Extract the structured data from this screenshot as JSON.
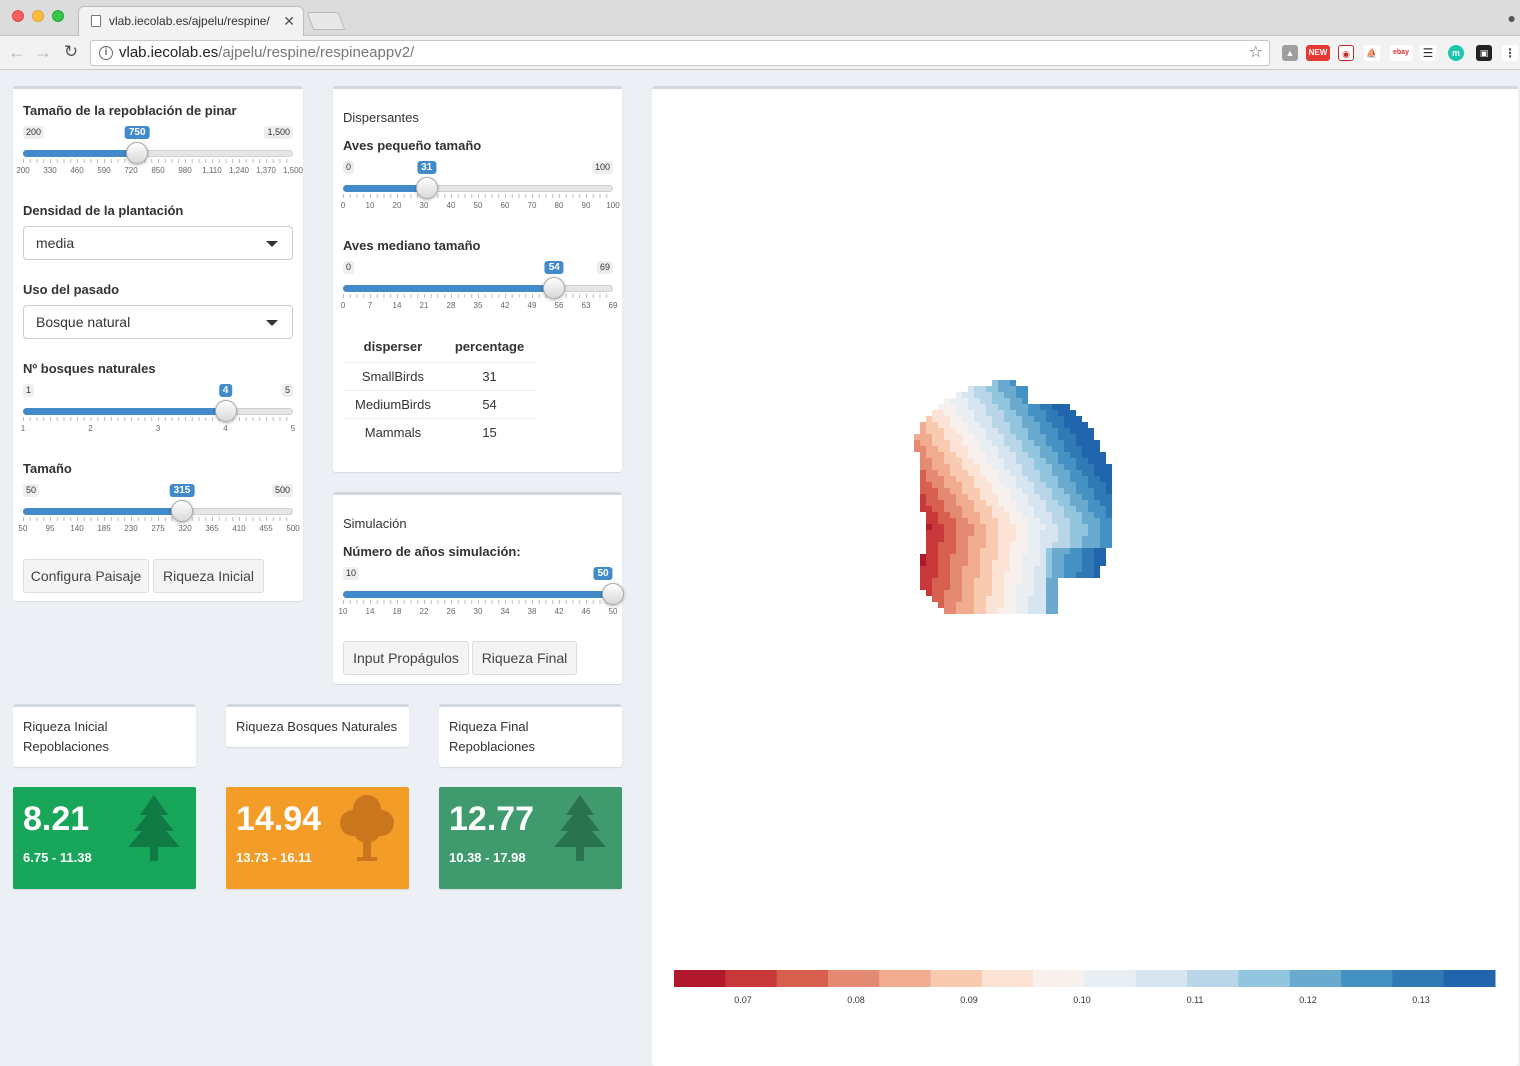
{
  "browser": {
    "tab_title": "vlab.iecolab.es/ajpelu/respine/",
    "url_host": "vlab.iecolab.es",
    "url_path": "/ajpelu/respine/respineappv2/",
    "extension_badge": "NEW"
  },
  "landscape": {
    "pine_size": {
      "label": "Tamaño de la repoblación de pinar",
      "min": 200,
      "max": 1500,
      "value": 750,
      "min_label": "200",
      "max_label": "1,500",
      "value_label": "750",
      "ticks": [
        "200",
        "330",
        "460",
        "590",
        "720",
        "850",
        "980",
        "1,110",
        "1,240",
        "1,370",
        "1,500"
      ]
    },
    "density": {
      "label": "Densidad de la plantación",
      "value": "media"
    },
    "past_use": {
      "label": "Uso del pasado",
      "value": "Bosque natural"
    },
    "n_forests": {
      "label": "Nº bosques naturales",
      "min": 1,
      "max": 5,
      "value": 4,
      "min_label": "1",
      "max_label": "5",
      "value_label": "4",
      "ticks": [
        "1",
        "2",
        "3",
        "4",
        "5"
      ]
    },
    "size": {
      "label": "Tamaño",
      "min": 50,
      "max": 500,
      "value": 315,
      "min_label": "50",
      "max_label": "500",
      "value_label": "315",
      "ticks": [
        "50",
        "95",
        "140",
        "185",
        "230",
        "275",
        "320",
        "365",
        "410",
        "455",
        "500"
      ]
    },
    "configure_button": "Configura Paisaje",
    "initial_richness_button": "Riqueza Inicial"
  },
  "dispersers": {
    "title": "Dispersantes",
    "small_birds": {
      "label": "Aves pequeño tamaño",
      "min": 0,
      "max": 100,
      "value": 31,
      "min_label": "0",
      "max_label": "100",
      "value_label": "31",
      "ticks": [
        "0",
        "10",
        "20",
        "30",
        "40",
        "50",
        "60",
        "70",
        "80",
        "90",
        "100"
      ]
    },
    "medium_birds": {
      "label": "Aves mediano tamaño",
      "min": 0,
      "max": 69,
      "value": 54,
      "min_label": "0",
      "max_label": "69",
      "value_label": "54",
      "ticks": [
        "0",
        "7",
        "14",
        "21",
        "28",
        "35",
        "42",
        "49",
        "56",
        "63",
        "69"
      ]
    },
    "table": {
      "headers": [
        "disperser",
        "percentage"
      ],
      "rows": [
        [
          "SmallBirds",
          "31"
        ],
        [
          "MediumBirds",
          "54"
        ],
        [
          "Mammals",
          "15"
        ]
      ]
    }
  },
  "simulation": {
    "title": "Simulación",
    "years": {
      "label": "Número de años simulación:",
      "min": 10,
      "max": 50,
      "value": 50,
      "min_label": "10",
      "max_label": "",
      "value_label": "50",
      "ticks": [
        "10",
        "14",
        "18",
        "22",
        "26",
        "30",
        "34",
        "38",
        "42",
        "46",
        "50"
      ]
    },
    "propagule_button": "Input Propágulos",
    "final_button": "Riqueza Final"
  },
  "value_labels": {
    "initial": [
      "Riqueza Inicial",
      "Repoblaciones"
    ],
    "natural": "Riqueza Bosques Naturales",
    "final": [
      "Riqueza Final",
      "Repoblaciones"
    ]
  },
  "value_boxes": [
    {
      "value": "8.21",
      "range": "6.75 - 11.38",
      "color": "#18a65b",
      "icon": "pine-tree-icon",
      "icon_color": "#0f7a44"
    },
    {
      "value": "14.94",
      "range": "13.73 - 16.11",
      "color": "#f39c27",
      "icon": "deciduous-tree-icon",
      "icon_color": "#c9761c"
    },
    {
      "value": "12.77",
      "range": "10.38 - 17.98",
      "color": "#3f9a6d",
      "icon": "pine-tree-icon",
      "icon_color": "#2a7350"
    }
  ],
  "map": {
    "legend_colors": [
      "#b2182b",
      "#c8383a",
      "#d6604d",
      "#e48a73",
      "#f1ab8f",
      "#f8cbb0",
      "#fbe3d6",
      "#f7f0ec",
      "#e9eef3",
      "#d6e5f0",
      "#b8d6e8",
      "#92c5de",
      "#6aaace",
      "#4392c3",
      "#2f79b5",
      "#2166ac"
    ],
    "legend_ticks": [
      "0.07",
      "0.08",
      "0.09",
      "0.10",
      "0.11",
      "0.12",
      "0.13"
    ]
  }
}
